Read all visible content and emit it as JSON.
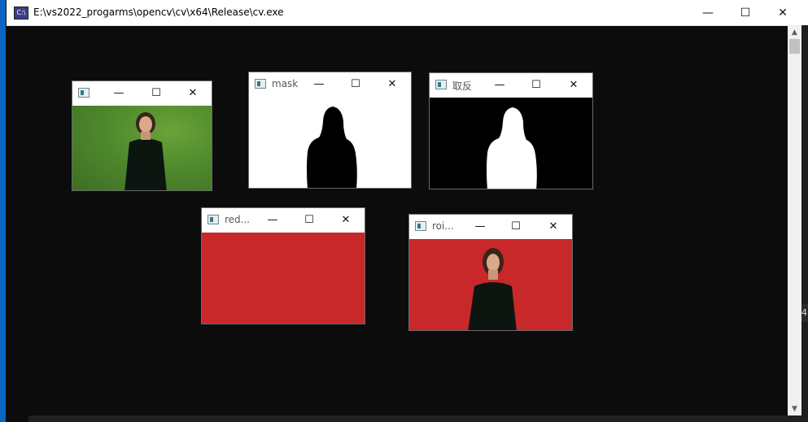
{
  "console": {
    "title": "E:\\vs2022_progarms\\opencv\\cv\\x64\\Release\\cv.exe",
    "app_icon": "C:\\",
    "minimize": "—",
    "maximize": "☐",
    "close": "✕",
    "right_peek": "4"
  },
  "windows": [
    {
      "id": "original",
      "title": "",
      "content": "green-person"
    },
    {
      "id": "mask",
      "title": "mask",
      "content": "mask"
    },
    {
      "id": "invert",
      "title": "取反",
      "content": "inverted"
    },
    {
      "id": "red",
      "title": "red...",
      "content": "red"
    },
    {
      "id": "roi",
      "title": "roi...",
      "content": "red-person"
    }
  ],
  "colors": {
    "console_bg": "#0c0c0c",
    "red_bg": "#c8282a",
    "green_bg": "#4f8a2d",
    "accent": "#0a66c2"
  }
}
